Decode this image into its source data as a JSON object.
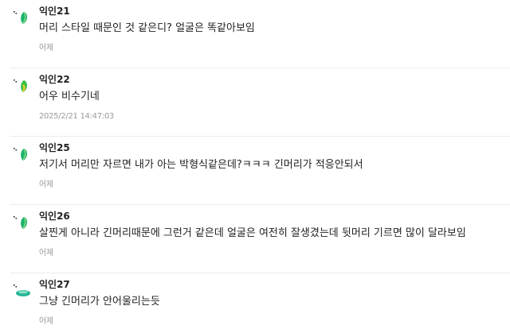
{
  "comments": [
    {
      "author": "익인21",
      "text": "머리 스타일 때문인 것 같은디? 얼굴은 똑같아보임",
      "time": "어제",
      "avatar_icon": "green-leaf-icon",
      "avatar_color": "#2bb673"
    },
    {
      "author": "익인22",
      "text": "어우 비수기네",
      "time": "2025/2/21 14:47:03",
      "avatar_icon": "green-leaf-icon",
      "avatar_color": "#3fc24a"
    },
    {
      "author": "익인25",
      "text": "저기서 머리만 자르면 내가 아는 박형식같은데?ㅋㅋㅋ 긴머리가 적응안되서",
      "time": "어제",
      "avatar_icon": "green-leaf-icon",
      "avatar_color": "#2bb673"
    },
    {
      "author": "익인26",
      "text": "살찐게 아니라 긴머리때문에 그런거 같은데 얼굴은 여전히 잘생겼는데 뒷머리 기르면 많이 달라보임",
      "time": "어제",
      "avatar_icon": "green-leaf-icon",
      "avatar_color": "#2bb673"
    },
    {
      "author": "익인27",
      "text": "그냥 긴머리가 안어울리는듯",
      "time": "어제",
      "avatar_icon": "green-sprout-icon",
      "avatar_color": "#28b497"
    }
  ]
}
